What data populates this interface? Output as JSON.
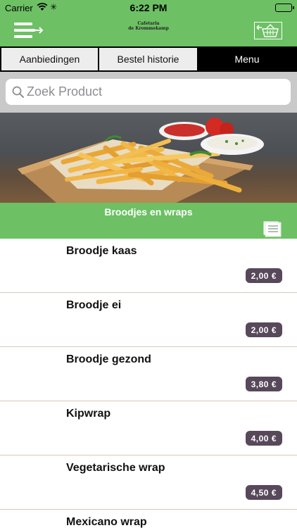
{
  "status_bar": {
    "carrier": "Carrier",
    "time": "6:22 PM"
  },
  "header": {
    "logo_line1": "Cafetaria",
    "logo_line2": "de Krommekamp",
    "icons": [
      "menu-arrow-icon",
      "basket-back-icon"
    ]
  },
  "tabs": [
    {
      "label": "Aanbiedingen",
      "active": false
    },
    {
      "label": "Bestel historie",
      "active": false
    },
    {
      "label": "Menu",
      "active": true
    }
  ],
  "search": {
    "placeholder": "Zoek Product"
  },
  "category": {
    "title": "Broodjes en wraps"
  },
  "products": [
    {
      "name": "Broodje kaas",
      "price": "2,00 €"
    },
    {
      "name": "Broodje ei",
      "price": "2,00 €"
    },
    {
      "name": "Broodje gezond",
      "price": "3,80 €"
    },
    {
      "name": "Kipwrap",
      "price": "4,00 €"
    },
    {
      "name": "Vegetarische wrap",
      "price": "4,50 €"
    },
    {
      "name": "Mexicano wrap",
      "price": ""
    }
  ],
  "colors": {
    "brand_green": "#6dc064",
    "price_badge": "#57485a",
    "active_tab": "#000000",
    "inactive_tab": "#ededed"
  }
}
